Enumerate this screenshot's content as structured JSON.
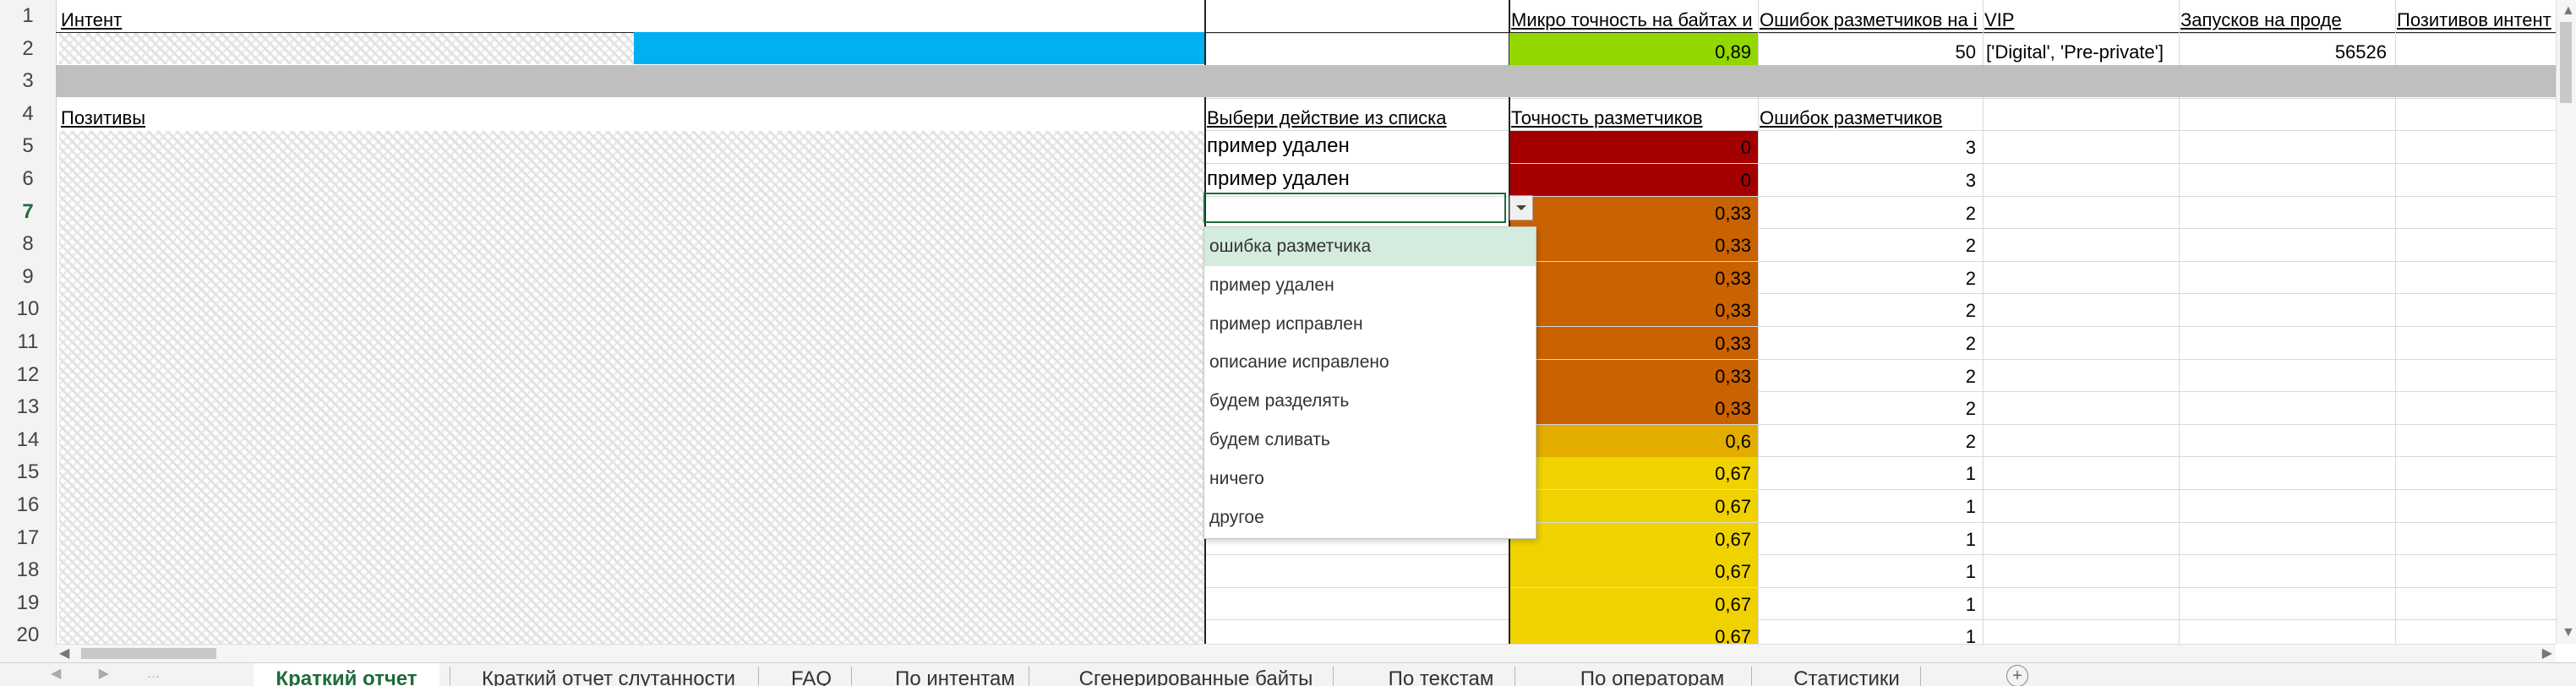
{
  "row_numbers": [
    "1",
    "2",
    "3",
    "4",
    "5",
    "6",
    "7",
    "8",
    "9",
    "10",
    "11",
    "12",
    "13",
    "14",
    "15",
    "16",
    "17",
    "18",
    "19",
    "20"
  ],
  "header_row": {
    "col_b": "Интент",
    "col_e": "Микро точность на байтах и",
    "col_f": "Ошибок разметчиков на і",
    "col_g": "VIP",
    "col_h": "Запусков на проде",
    "col_i": "Позитивов интент"
  },
  "row2": {
    "micro_accuracy": "0,89",
    "annotator_errors": "50",
    "vip": "['Digital', 'Pre-private']",
    "launches": "56526"
  },
  "row4": {
    "col_b": "Позитивы",
    "col_d": "Выбери действие из списка",
    "col_e": "Точность разметчиков",
    "col_f": "Ошибок разметчиков"
  },
  "data_rows": [
    {
      "action": "пример удален",
      "accuracy": "0",
      "errors": "3",
      "color": "#a50000"
    },
    {
      "action": "пример удален",
      "accuracy": "0",
      "errors": "3",
      "color": "#a50000"
    },
    {
      "action": "",
      "accuracy": "0,33",
      "errors": "2",
      "color": "#c96200"
    },
    {
      "action": "",
      "accuracy": "0,33",
      "errors": "2",
      "color": "#c96200"
    },
    {
      "action": "",
      "accuracy": "0,33",
      "errors": "2",
      "color": "#c96200"
    },
    {
      "action": "",
      "accuracy": "0,33",
      "errors": "2",
      "color": "#c96200"
    },
    {
      "action": "",
      "accuracy": "0,33",
      "errors": "2",
      "color": "#c96200"
    },
    {
      "action": "",
      "accuracy": "0,33",
      "errors": "2",
      "color": "#c96200"
    },
    {
      "action": "",
      "accuracy": "0,33",
      "errors": "2",
      "color": "#c96200"
    },
    {
      "action": "",
      "accuracy": "0,6",
      "errors": "2",
      "color": "#e3ad00"
    },
    {
      "action": "",
      "accuracy": "0,67",
      "errors": "1",
      "color": "#efd200"
    },
    {
      "action": "",
      "accuracy": "0,67",
      "errors": "1",
      "color": "#efd200"
    },
    {
      "action": "",
      "accuracy": "0,67",
      "errors": "1",
      "color": "#efd200"
    },
    {
      "action": "",
      "accuracy": "0,67",
      "errors": "1",
      "color": "#efd200"
    },
    {
      "action": "",
      "accuracy": "0,67",
      "errors": "1",
      "color": "#efd200"
    },
    {
      "action": "",
      "accuracy": "0,67",
      "errors": "1",
      "color": "#efd200"
    }
  ],
  "dropdown_options": [
    "ошибка разметчика",
    "пример удален",
    "пример исправлен",
    "описание исправлено",
    "будем разделять",
    "будем сливать",
    "ничего",
    "другое"
  ],
  "sheet_tabs": [
    "Краткий отчет",
    "Краткий отчет слутанности",
    "FAQ",
    "По интентам",
    "Сгенерированные байты",
    "По текстам",
    "По операторам",
    "Статистики"
  ],
  "active_tab": "Краткий отчет",
  "active_row": "7",
  "colors": {
    "green_cell": "#92d800",
    "blue_cell": "#00b0f0",
    "gray_row": "#bfbfbf",
    "accent": "#1e6b3c"
  }
}
